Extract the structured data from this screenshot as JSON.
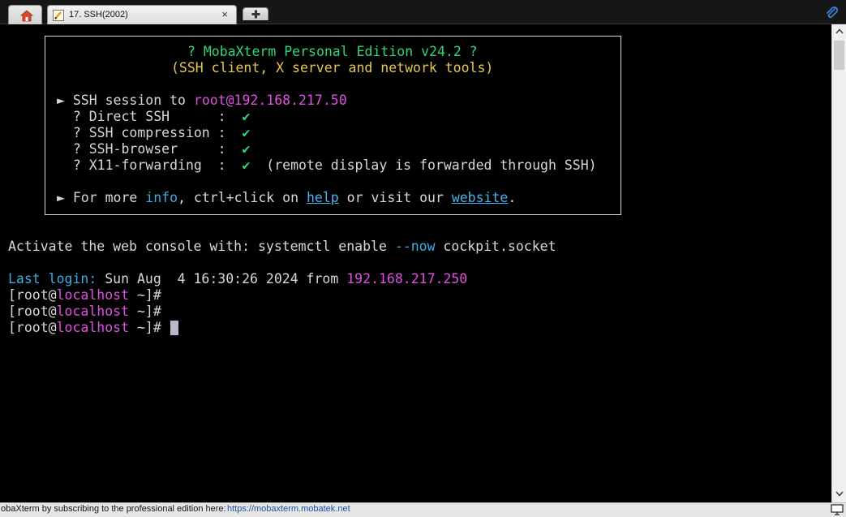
{
  "tabs": {
    "home_icon": "home-icon",
    "session_title": "17. SSH(2002)",
    "close_glyph": "×",
    "new_tab_icon": "plus-icon"
  },
  "terminal": {
    "banner_title": "? MobaXterm Personal Edition v24.2 ?",
    "banner_subtitle": "(SSH client, X server and network tools)",
    "session_prefix": "► SSH session to ",
    "session_target": "root@192.168.217.50",
    "features": [
      {
        "label": "  ? Direct SSH      :  ",
        "check": "✔",
        "note": ""
      },
      {
        "label": "  ? SSH compression :  ",
        "check": "✔",
        "note": ""
      },
      {
        "label": "  ? SSH-browser     :  ",
        "check": "✔",
        "note": ""
      },
      {
        "label": "  ? X11-forwarding  :  ",
        "check": "✔",
        "note": "  (remote display is forwarded through SSH)"
      }
    ],
    "more_prefix": "► For more ",
    "more_info": "info",
    "more_mid": ", ctrl+click on ",
    "more_help": "help",
    "more_mid2": " or visit our ",
    "more_website": "website",
    "more_end": ".",
    "activate_prefix": "Activate the web console with: systemctl enable ",
    "activate_flag": "--now",
    "activate_suffix": " cockpit.socket",
    "last_login_label": "Last login:",
    "last_login_time": " Sun Aug  4 16:30:26 2024 from ",
    "last_login_ip": "192.168.217.250",
    "prompt_open": "[root@",
    "prompt_host": "localhost",
    "prompt_close": " ~]#"
  },
  "statusbar": {
    "text": "obaXterm by subscribing to the professional edition here:",
    "url": "https://mobaxterm.mobatek.net"
  },
  "colors": {
    "green": "#2fd67b",
    "yellow": "#e7c84e",
    "magenta": "#e050e0",
    "cyan": "#3aaee8"
  }
}
